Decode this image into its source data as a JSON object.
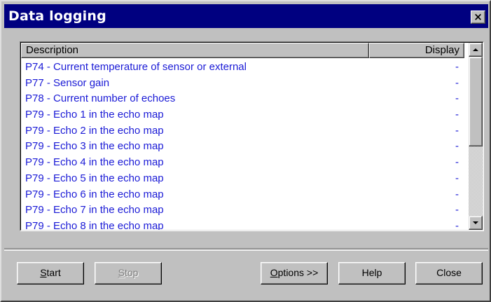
{
  "window": {
    "title": "Data logging",
    "close_glyph": "×"
  },
  "list": {
    "columns": [
      "Description",
      "Display"
    ],
    "rows": [
      {
        "description": "P74 - Current temperature of sensor or external",
        "display": "-"
      },
      {
        "description": "P77 - Sensor gain",
        "display": "-"
      },
      {
        "description": "P78 - Current number of echoes",
        "display": "-"
      },
      {
        "description": "P79 - Echo 1 in the echo map",
        "display": "-"
      },
      {
        "description": "P79 - Echo 2 in the echo map",
        "display": "-"
      },
      {
        "description": "P79 - Echo 3 in the echo map",
        "display": "-"
      },
      {
        "description": "P79 - Echo 4 in the echo map",
        "display": "-"
      },
      {
        "description": "P79 - Echo 5 in the echo map",
        "display": "-"
      },
      {
        "description": "P79 - Echo 6 in the echo map",
        "display": "-"
      },
      {
        "description": "P79 - Echo 7 in the echo map",
        "display": "-"
      },
      {
        "description": "P79 - Echo 8 in the echo map",
        "display": "-"
      }
    ],
    "row_text_color": "#1a1ad6"
  },
  "buttons": {
    "start": {
      "hotkey": "S",
      "rest": "tart"
    },
    "stop": {
      "hotkey": "S",
      "rest": "top",
      "disabled": true
    },
    "options": {
      "hotkey": "O",
      "rest": "ptions >>"
    },
    "help": "Help",
    "close": "Close"
  },
  "colors": {
    "titlebar": "#000080",
    "face": "#c0c0c0"
  }
}
